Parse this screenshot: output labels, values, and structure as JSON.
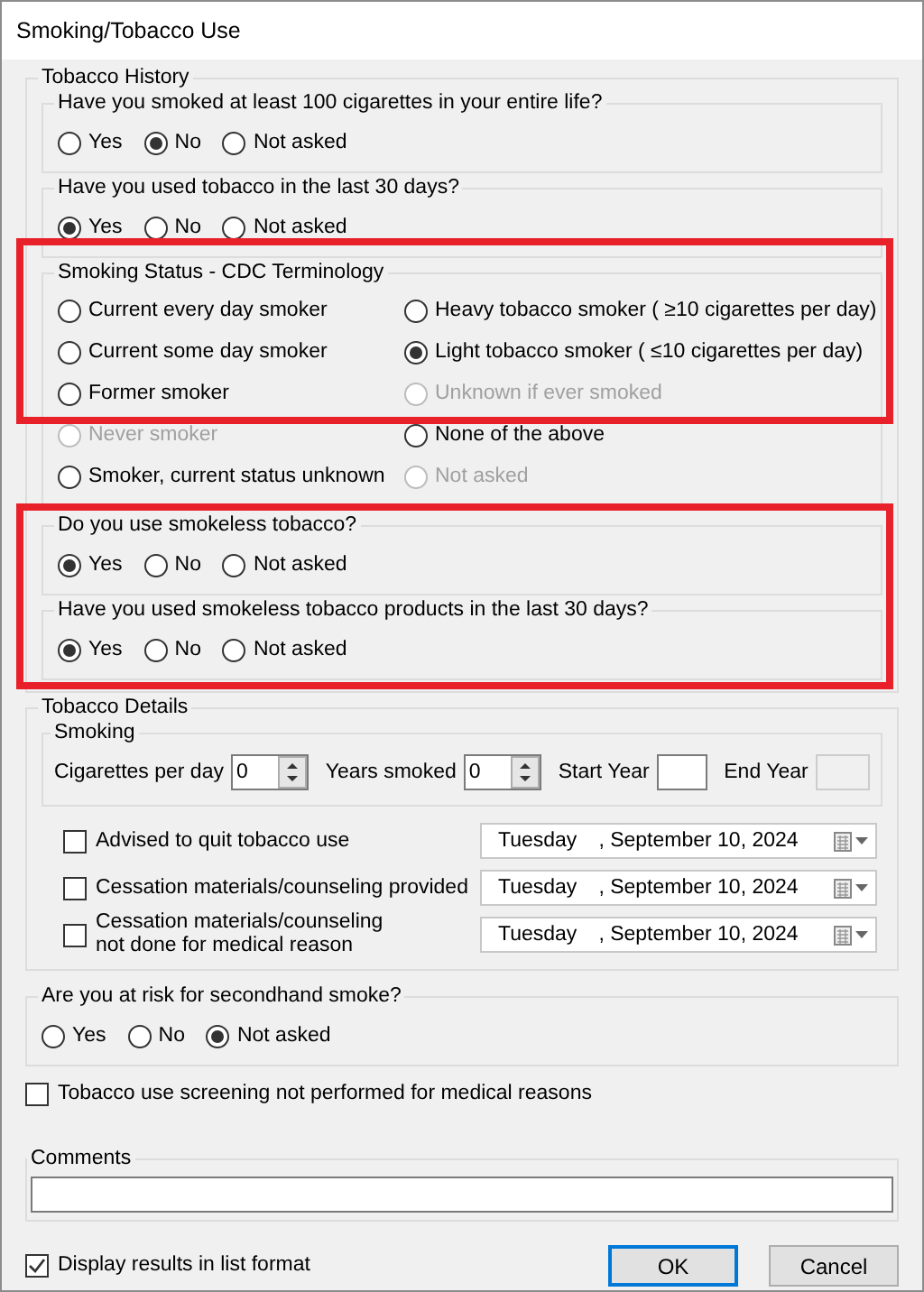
{
  "window": {
    "title": "Smoking/Tobacco Use"
  },
  "tobacco_history": {
    "title": "Tobacco History",
    "sections": [
      {
        "kind": "question",
        "question": "Have you smoked at least 100 cigarettes in your entire life?",
        "highlighted": false,
        "options": [
          {
            "label": "Yes",
            "selected": false
          },
          {
            "label": "No",
            "selected": true
          },
          {
            "label": "Not asked",
            "selected": false
          }
        ]
      },
      {
        "kind": "question",
        "question": "Have you used tobacco in the last 30 days?",
        "highlighted": false,
        "options": [
          {
            "label": "Yes",
            "selected": true
          },
          {
            "label": "No",
            "selected": false
          },
          {
            "label": "Not asked",
            "selected": false
          }
        ]
      },
      {
        "kind": "status",
        "title": "Smoking Status - CDC Terminology",
        "rows": [
          {
            "highlighted": true,
            "options": [
              {
                "label": "Current every day smoker",
                "selected": false,
                "disabled": false
              },
              {
                "label": "Heavy tobacco smoker ( ≥10 cigarettes per day)",
                "selected": false,
                "disabled": false
              }
            ]
          },
          {
            "highlighted": true,
            "options": [
              {
                "label": "Current some day smoker",
                "selected": false,
                "disabled": false
              },
              {
                "label": "Light tobacco smoker ( ≤10 cigarettes per day)",
                "selected": true,
                "disabled": false
              }
            ]
          },
          {
            "highlighted": true,
            "options": [
              {
                "label": "Former smoker",
                "selected": false,
                "disabled": false
              },
              {
                "label": "Unknown if ever smoked",
                "selected": false,
                "disabled": true
              }
            ]
          },
          {
            "highlighted": false,
            "options": [
              {
                "label": "Never smoker",
                "selected": false,
                "disabled": true
              },
              {
                "label": "None of the above",
                "selected": false,
                "disabled": false
              }
            ]
          },
          {
            "highlighted": false,
            "options": [
              {
                "label": "Smoker, current status unknown",
                "selected": false,
                "disabled": false
              },
              {
                "label": "Not asked",
                "selected": false,
                "disabled": true
              }
            ]
          }
        ]
      },
      {
        "kind": "question",
        "question": "Do you use smokeless tobacco?",
        "highlighted": true,
        "options": [
          {
            "label": "Yes",
            "selected": true
          },
          {
            "label": "No",
            "selected": false
          },
          {
            "label": "Not asked",
            "selected": false
          }
        ]
      },
      {
        "kind": "question",
        "question": "Have you used smokeless tobacco products in the last 30 days?",
        "highlighted": true,
        "options": [
          {
            "label": "Yes",
            "selected": true
          },
          {
            "label": "No",
            "selected": false
          },
          {
            "label": "Not asked",
            "selected": false
          }
        ]
      }
    ]
  },
  "tobacco_details": {
    "title": "Tobacco Details",
    "smoking": {
      "title": "Smoking",
      "fields": [
        {
          "kind": "spinner",
          "label": "Cigarettes per day",
          "value": "0"
        },
        {
          "kind": "spinner",
          "label": "Years smoked",
          "value": "0"
        },
        {
          "kind": "year",
          "label": "Start Year",
          "disabled": false
        },
        {
          "kind": "year",
          "label": "End Year",
          "disabled": true
        }
      ]
    },
    "actions": [
      {
        "label": "Advised to quit tobacco use",
        "checked": false,
        "day": "Tuesday",
        "date": ", September 10, 2024"
      },
      {
        "label": "Cessation materials/counseling provided",
        "checked": false,
        "day": "Tuesday",
        "date": ", September 10, 2024"
      },
      {
        "label": "Cessation materials/counseling\nnot done for medical reason",
        "checked": false,
        "day": "Tuesday",
        "date": ", September 10, 2024"
      }
    ]
  },
  "secondhand": {
    "question": "Are you at risk for secondhand smoke?",
    "options": [
      {
        "label": "Yes",
        "selected": false
      },
      {
        "label": "No",
        "selected": false
      },
      {
        "label": "Not asked",
        "selected": true
      }
    ]
  },
  "screening": {
    "label": "Tobacco use screening not performed for medical reasons",
    "checked": false
  },
  "comments": {
    "title": "Comments"
  },
  "footer": {
    "list_format": {
      "label": "Display results in list format",
      "checked": true
    },
    "buttons": [
      {
        "label": "OK",
        "default": true
      },
      {
        "label": "Cancel",
        "default": false
      }
    ]
  }
}
